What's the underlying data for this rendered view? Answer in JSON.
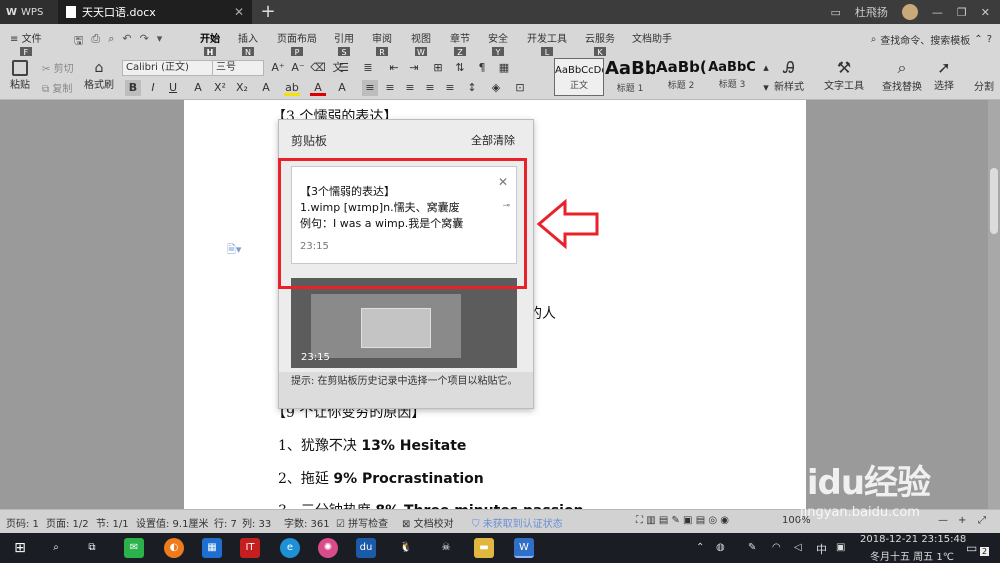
{
  "titlebar": {
    "app_name": "WPS",
    "doc_tab_title": "天天口语.docx",
    "close_glyph": "✕",
    "new_tab_glyph": "+",
    "user_name": "杜飛扬"
  },
  "menu": {
    "file": "文件",
    "file_key": "F",
    "tabs": [
      {
        "label": "开始",
        "key": "H"
      },
      {
        "label": "插入",
        "key": "N"
      },
      {
        "label": "页面布局",
        "key": "P"
      },
      {
        "label": "引用",
        "key": "S"
      },
      {
        "label": "审阅",
        "key": "R"
      },
      {
        "label": "视图",
        "key": "W"
      },
      {
        "label": "章节",
        "key": "Z"
      },
      {
        "label": "安全",
        "key": "Y"
      },
      {
        "label": "开发工具",
        "key": "L"
      },
      {
        "label": "云服务",
        "key": "K"
      },
      {
        "label": "文档助手",
        "key": ""
      }
    ],
    "search_placeholder": "查找命令、搜索模板"
  },
  "ribbon": {
    "paste": "粘贴",
    "cut": "剪切",
    "copy": "复制",
    "format_painter": "格式刷",
    "font_name": "Calibri (正文)",
    "font_size": "三号",
    "styles": [
      {
        "sample": "AaBbCcDd",
        "label": "正文"
      },
      {
        "sample": "AaBb",
        "label": "标题 1"
      },
      {
        "sample": "AaBb(",
        "label": "标题 2"
      },
      {
        "sample": "AaBbC",
        "label": "标题 3"
      }
    ],
    "new_style": "新样式",
    "text_tools": "文字工具",
    "find_replace": "查找替换",
    "select": "选择",
    "split": "分割"
  },
  "document": {
    "heading1": "【3 个懦弱的表达】",
    "fragment_suffix": "的人",
    "heading2": "【9 个让你变穷的原因】",
    "items": [
      {
        "prefix": "1、犹豫不决",
        "en": "13% Hesitate"
      },
      {
        "prefix": "2、拖延",
        "en": "9% Procrastination"
      },
      {
        "prefix": "3、三分钟热度",
        "en": "8% Three minutes passion"
      }
    ]
  },
  "clipboard": {
    "title": "剪贴板",
    "clear_all": "全部清除",
    "card": {
      "line1": "【3个懦弱的表达】",
      "line2": "1.wimp [wɪmp]n.懦夫、窝囊废",
      "line3": "例句：I was a wimp.我是个窝囊",
      "time": "23:15"
    },
    "thumb_time": "23:15",
    "hint": "提示: 在剪贴板历史记录中选择一个项目以粘贴它。"
  },
  "statusbar": {
    "page_num": "页码: 1",
    "pages": "页面: 1/2",
    "section": "节: 1/1",
    "setting": "设置值: 9.1厘米",
    "row": "行: 7",
    "col": "列: 33",
    "word_count": "字数: 361",
    "spell_check": "拼写检查",
    "doc_check": "文档校对",
    "auth": "未获取到认证状态",
    "zoom": "100%"
  },
  "taskbar": {
    "ime": "中",
    "date": "2018-12-21",
    "time": "23:15:48",
    "lunar": "冬月十五 周五 1℃",
    "notif_count": "2"
  },
  "watermark": {
    "brand": "Baidu经验",
    "url": "jingyan.baidu.com"
  },
  "colors": {
    "highlight_red": "#e8212a",
    "titlebar": "#3c3c3c",
    "taskbar": "#1a1d24"
  }
}
